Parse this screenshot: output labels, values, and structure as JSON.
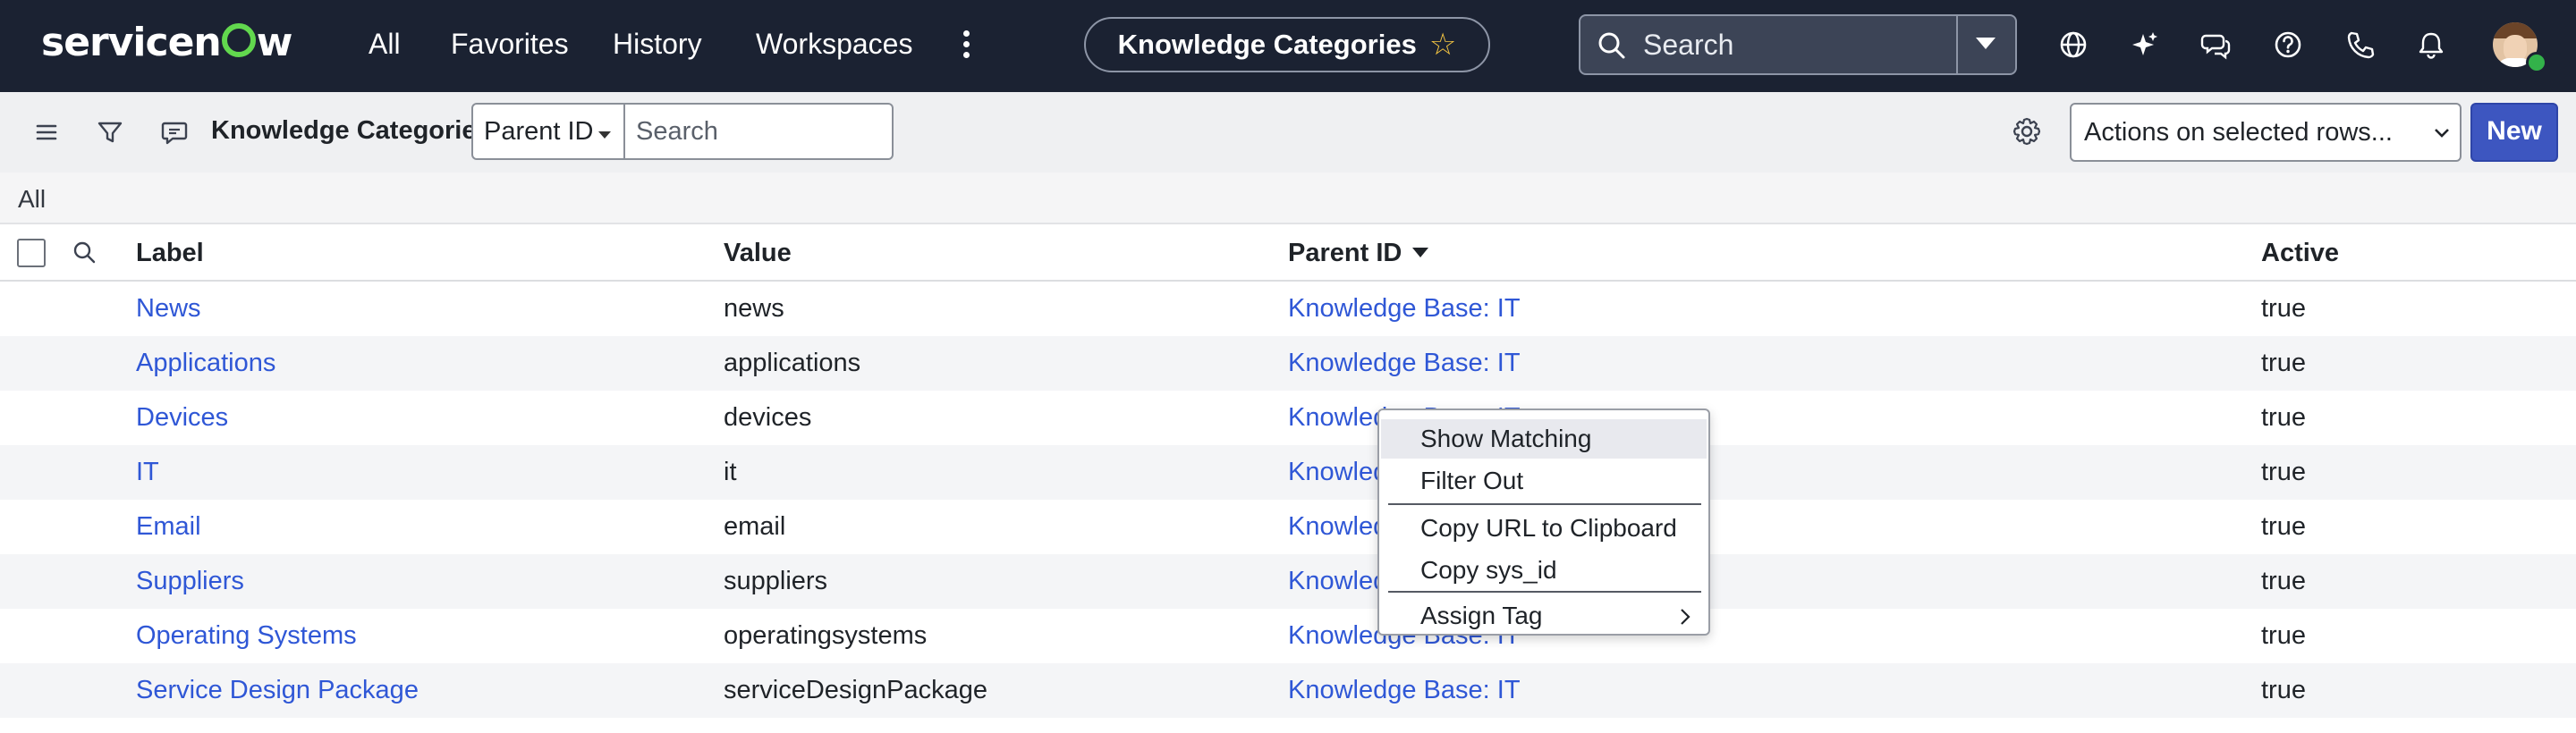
{
  "topnav": {
    "logo": {
      "pre": "servicen",
      "post": "w"
    },
    "links": [
      "All",
      "Favorites",
      "History",
      "Workspaces"
    ],
    "context_pill": {
      "label": "Knowledge Categories",
      "icon": "star-icon"
    },
    "search": {
      "placeholder": "Search"
    },
    "icons": [
      "globe-icon",
      "sparkle-icon",
      "chat-icon",
      "help-icon",
      "phone-icon",
      "bell-icon"
    ]
  },
  "toolbar": {
    "title": "Knowledge Categories",
    "field_select": "Parent ID",
    "search_placeholder": "Search",
    "actions_select": "Actions on selected rows...",
    "new_label": "New"
  },
  "breadcrumb": {
    "text": "All"
  },
  "table": {
    "headers": {
      "label": "Label",
      "value": "Value",
      "parent": "Parent ID",
      "active": "Active"
    },
    "rows": [
      {
        "label": "News",
        "value": "news",
        "parent": "Knowledge Base: IT",
        "active": "true"
      },
      {
        "label": "Applications",
        "value": "applications",
        "parent": "Knowledge Base: IT",
        "active": "true"
      },
      {
        "label": "Devices",
        "value": "devices",
        "parent": "Knowledge Base: IT",
        "active": "true"
      },
      {
        "label": "IT",
        "value": "it",
        "parent": "Knowledge Base: IT",
        "active": "true"
      },
      {
        "label": "Email",
        "value": "email",
        "parent": "Knowledge Base: IT",
        "active": "true"
      },
      {
        "label": "Suppliers",
        "value": "suppliers",
        "parent": "Knowledge Base: IT",
        "active": "true"
      },
      {
        "label": "Operating Systems",
        "value": "operatingsystems",
        "parent": "Knowledge Base: IT",
        "active": "true"
      },
      {
        "label": "Service Design Package",
        "value": "serviceDesignPackage",
        "parent": "Knowledge Base: IT",
        "active": "true"
      }
    ]
  },
  "context_menu": {
    "items": [
      "Show Matching",
      "Filter Out",
      "Copy URL to Clipboard",
      "Copy sys_id",
      "Assign Tag"
    ]
  },
  "colors": {
    "nav_bg": "#1b2232",
    "link": "#2f57d6",
    "primary_button": "#3d56c0",
    "logo_accent": "#62d84e"
  }
}
